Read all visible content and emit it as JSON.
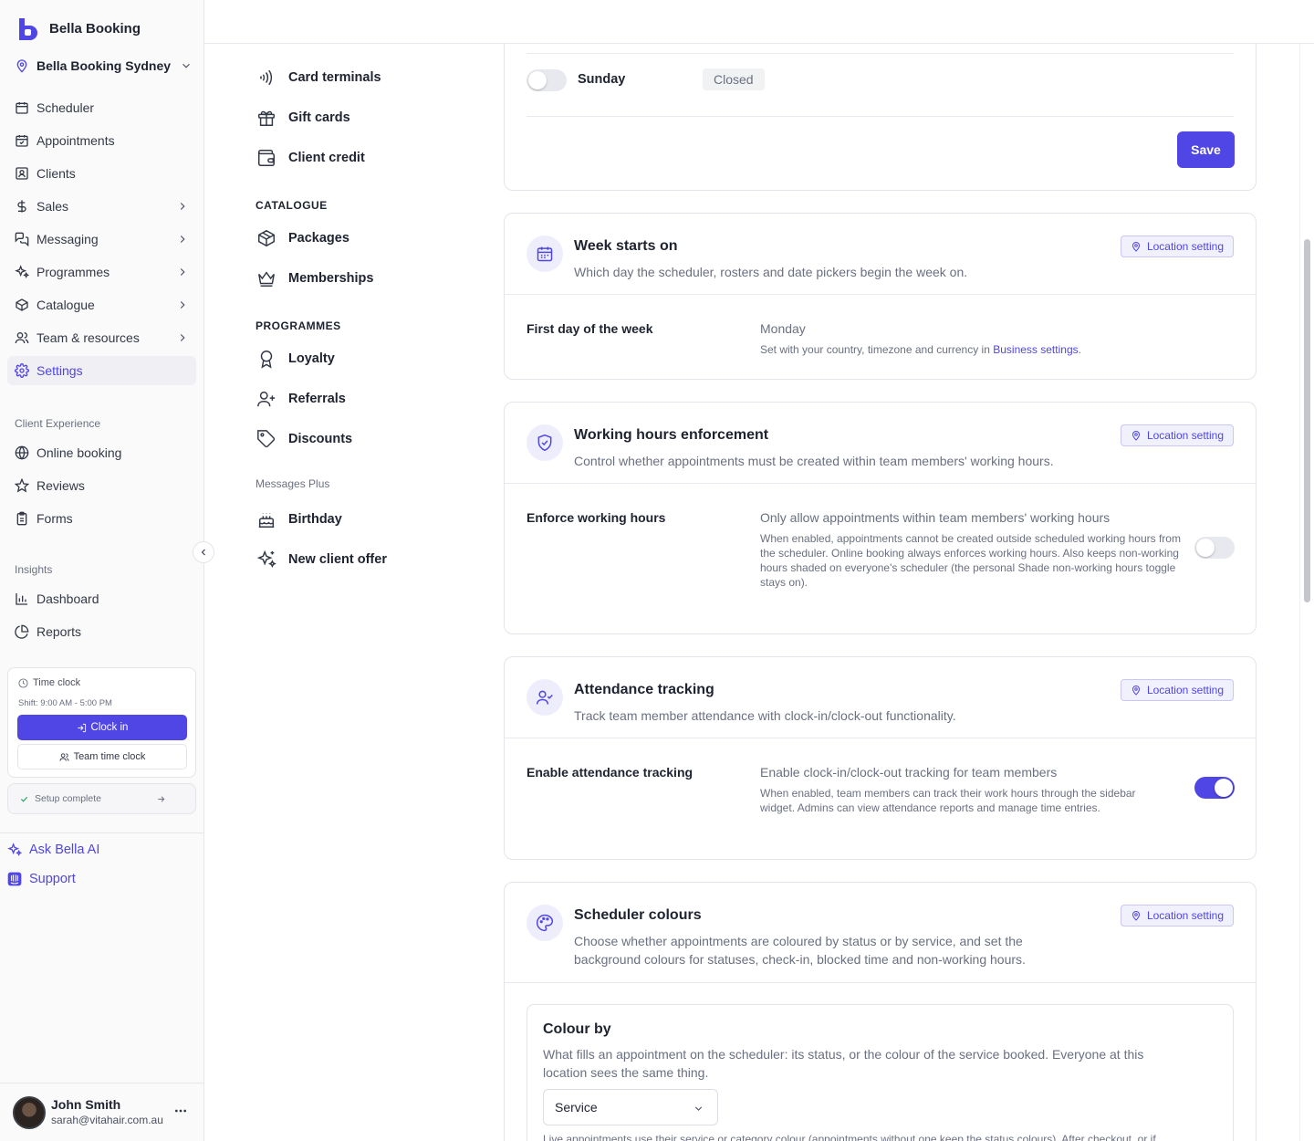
{
  "brand": {
    "name": "Bella Booking"
  },
  "location": {
    "name": "Bella Booking Sydney"
  },
  "nav": {
    "main": [
      {
        "label": "Scheduler",
        "icon": "calendar-icon"
      },
      {
        "label": "Appointments",
        "icon": "calendar-check-icon"
      },
      {
        "label": "Clients",
        "icon": "contact-icon"
      },
      {
        "label": "Sales",
        "icon": "dollar-icon"
      },
      {
        "label": "Messaging",
        "icon": "messages-icon"
      },
      {
        "label": "Programmes",
        "icon": "sparkles-icon"
      },
      {
        "label": "Catalogue",
        "icon": "box-icon"
      },
      {
        "label": "Team & resources",
        "icon": "users-icon"
      },
      {
        "label": "Settings",
        "icon": "gear-icon"
      }
    ],
    "client_experience_heading": "Client Experience",
    "client_experience": [
      {
        "label": "Online booking",
        "icon": "globe-icon"
      },
      {
        "label": "Reviews",
        "icon": "star-icon"
      },
      {
        "label": "Forms",
        "icon": "clipboard-icon"
      }
    ],
    "insights_heading": "Insights",
    "insights": [
      {
        "label": "Dashboard",
        "icon": "bar-chart-icon"
      },
      {
        "label": "Reports",
        "icon": "pie-chart-icon"
      }
    ]
  },
  "timeclock": {
    "title": "Time clock",
    "shift": "Shift: 9:00 AM - 5:00 PM",
    "clock_in_label": "Clock in",
    "team_label": "Team time clock"
  },
  "setup": {
    "label": "Setup complete"
  },
  "bottom_links": {
    "ai": "Ask Bella AI",
    "support": "Support"
  },
  "user": {
    "name": "John Smith",
    "email": "sarah@vitahair.com.au"
  },
  "settings_nav": {
    "payments_items": [
      {
        "label": "Card terminals",
        "icon": "contactless-icon"
      },
      {
        "label": "Gift cards",
        "icon": "gift-icon"
      },
      {
        "label": "Client credit",
        "icon": "wallet-icon"
      }
    ],
    "catalogue_heading": "CATALOGUE",
    "catalogue_items": [
      {
        "label": "Packages",
        "icon": "package-icon"
      },
      {
        "label": "Memberships",
        "icon": "crown-icon"
      }
    ],
    "programmes_heading": "PROGRAMMES",
    "programmes_items": [
      {
        "label": "Loyalty",
        "icon": "award-icon"
      },
      {
        "label": "Referrals",
        "icon": "user-plus-icon"
      },
      {
        "label": "Discounts",
        "icon": "tag-icon"
      }
    ],
    "messages_heading": "Messages Plus",
    "messages_items": [
      {
        "label": "Birthday",
        "icon": "cake-icon"
      },
      {
        "label": "New client offer",
        "icon": "sparkles-icon"
      }
    ]
  },
  "hours_card": {
    "day": "Sunday",
    "status": "Closed",
    "sunday_enabled": false,
    "save_label": "Save"
  },
  "location_badge": "Location setting",
  "week_card": {
    "title": "Week starts on",
    "desc": "Which day the scheduler, rosters and date pickers begin the week on.",
    "row_label": "First day of the week",
    "value": "Monday",
    "help_prefix": "Set with your country, timezone and currency in ",
    "help_link": "Business settings",
    "help_suffix": "."
  },
  "enforce_card": {
    "title": "Working hours enforcement",
    "desc": "Control whether appointments must be created within team members' working hours.",
    "row_label": "Enforce working hours",
    "value": "Only allow appointments within team members' working hours",
    "help": "When enabled, appointments cannot be created outside scheduled working hours from the scheduler. Online booking always enforces working hours. Also keeps non-working hours shaded on everyone's scheduler (the personal Shade non-working hours toggle stays on).",
    "enabled": false
  },
  "attendance_card": {
    "title": "Attendance tracking",
    "desc": "Track team member attendance with clock-in/clock-out functionality.",
    "row_label": "Enable attendance tracking",
    "value": "Enable clock-in/clock-out tracking for team members",
    "help": "When enabled, team members can track their work hours through the sidebar widget. Admins can view attendance reports and manage time entries.",
    "enabled": true
  },
  "colours_card": {
    "title": "Scheduler colours",
    "desc": "Choose whether appointments are coloured by status or by service, and set the background colours for statuses, check-in, blocked time and non-working hours.",
    "colour_by_title": "Colour by",
    "colour_by_desc": "What fills an appointment on the scheduler: its status, or the colour of the service booked. Everyone at this location sees the same thing.",
    "colour_by_value": "Service",
    "footer_text": "Live appointments use their service or category colour (appointments without one keep the status colours). After checkout, or if"
  },
  "colors": {
    "accent": "#4f46e5",
    "accent_soft": "#eeedfb"
  }
}
